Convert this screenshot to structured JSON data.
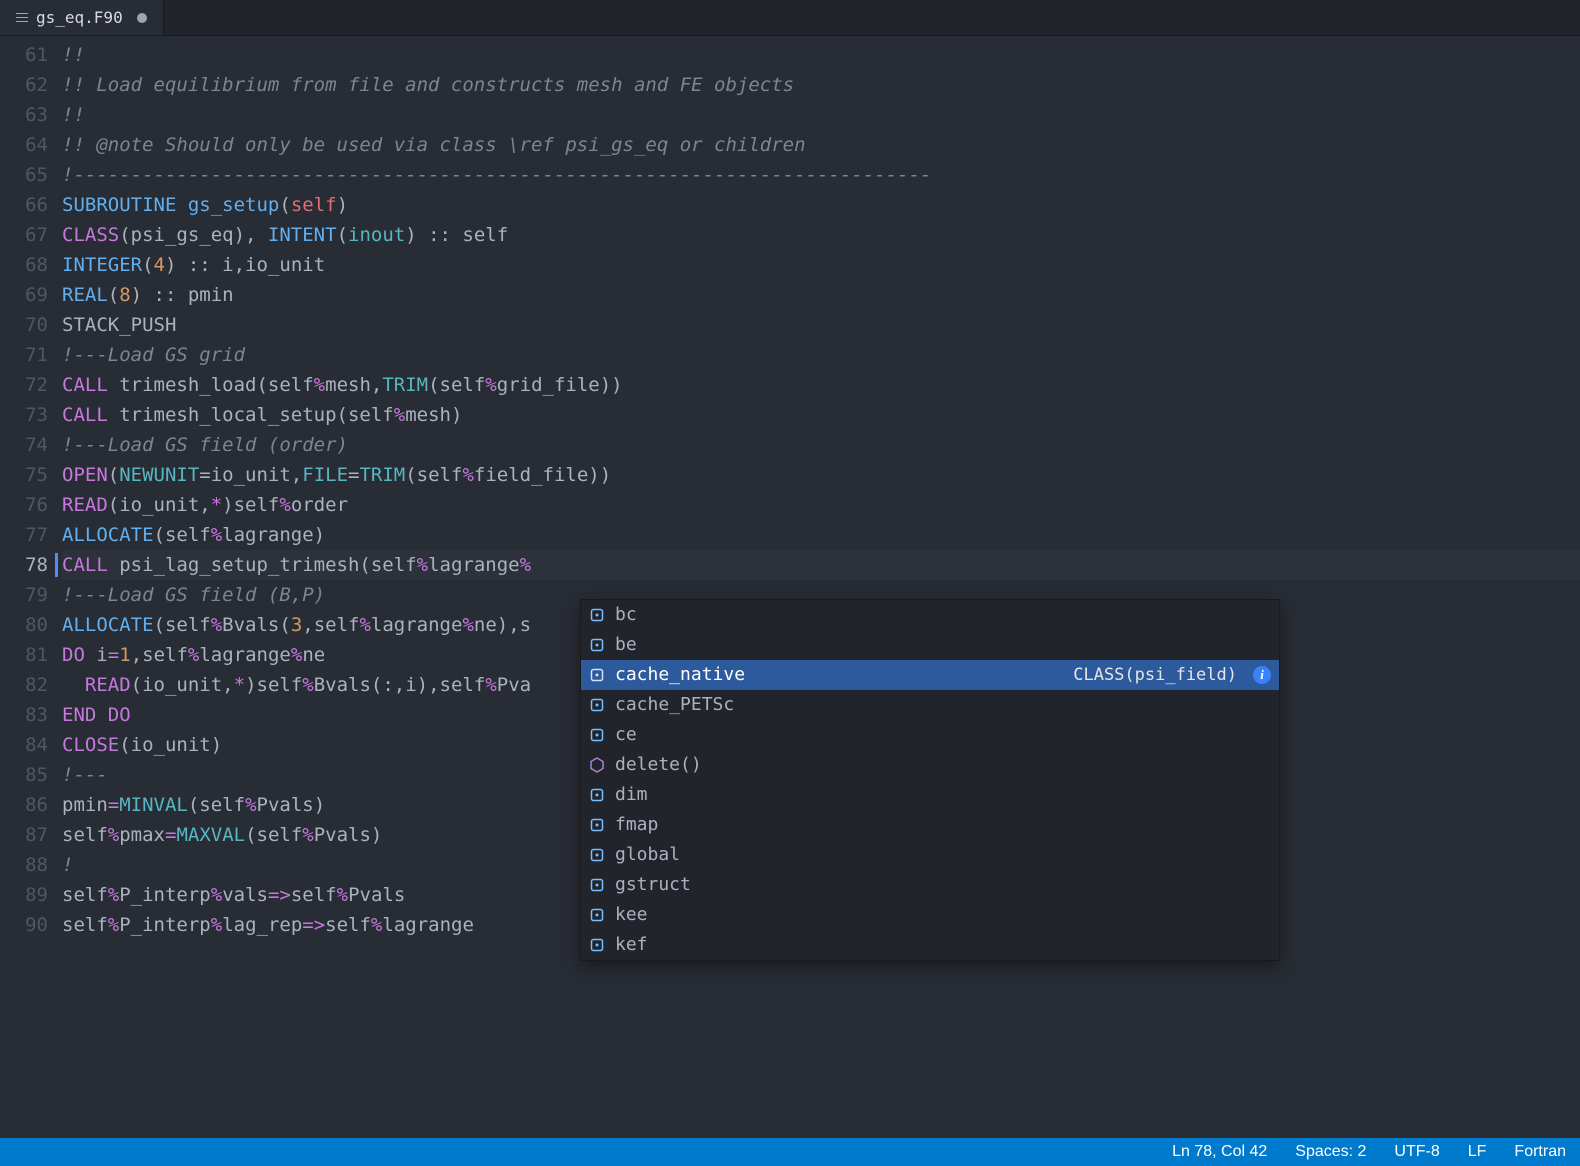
{
  "tab": {
    "file": "gs_eq.F90",
    "dirty": true
  },
  "editor": {
    "lines": [
      {
        "num": 61,
        "tokens": [
          {
            "c": "comment",
            "t": "!!"
          }
        ]
      },
      {
        "num": 62,
        "tokens": [
          {
            "c": "comment",
            "t": "!! Load equilibrium from file and constructs mesh and FE objects"
          }
        ]
      },
      {
        "num": 63,
        "tokens": [
          {
            "c": "comment",
            "t": "!!"
          }
        ]
      },
      {
        "num": 64,
        "tokens": [
          {
            "c": "comment",
            "t": "!! @note Should only be used via class \\ref psi_gs_eq or children"
          }
        ]
      },
      {
        "num": 65,
        "tokens": [
          {
            "c": "comment-dash",
            "t": "!---------------------------------------------------------------------------"
          }
        ]
      },
      {
        "num": 66,
        "tokens": [
          {
            "c": "keyword-blue",
            "t": "SUBROUTINE"
          },
          {
            "c": "ident",
            "t": " "
          },
          {
            "c": "call",
            "t": "gs_setup"
          },
          {
            "c": "punct",
            "t": "("
          },
          {
            "c": "self",
            "t": "self"
          },
          {
            "c": "punct",
            "t": ")"
          }
        ]
      },
      {
        "num": 67,
        "tokens": [
          {
            "c": "keyword",
            "t": "CLASS"
          },
          {
            "c": "punct",
            "t": "(psi_gs_eq), "
          },
          {
            "c": "keyword-blue",
            "t": "INTENT"
          },
          {
            "c": "punct",
            "t": "("
          },
          {
            "c": "type",
            "t": "inout"
          },
          {
            "c": "punct",
            "t": ") :: self"
          }
        ]
      },
      {
        "num": 68,
        "tokens": [
          {
            "c": "keyword-blue",
            "t": "INTEGER"
          },
          {
            "c": "punct",
            "t": "("
          },
          {
            "c": "num",
            "t": "4"
          },
          {
            "c": "punct",
            "t": ") :: i,io_unit"
          }
        ]
      },
      {
        "num": 69,
        "tokens": [
          {
            "c": "keyword-blue",
            "t": "REAL"
          },
          {
            "c": "punct",
            "t": "("
          },
          {
            "c": "num",
            "t": "8"
          },
          {
            "c": "punct",
            "t": ") :: pmin"
          }
        ]
      },
      {
        "num": 70,
        "tokens": [
          {
            "c": "ident",
            "t": "STACK_PUSH"
          }
        ]
      },
      {
        "num": 71,
        "tokens": [
          {
            "c": "comment",
            "t": "!---Load GS grid"
          }
        ]
      },
      {
        "num": 72,
        "tokens": [
          {
            "c": "keyword",
            "t": "CALL"
          },
          {
            "c": "ident",
            "t": " trimesh_load(self"
          },
          {
            "c": "keyword",
            "t": "%"
          },
          {
            "c": "ident",
            "t": "mesh,"
          },
          {
            "c": "builtin",
            "t": "TRIM"
          },
          {
            "c": "punct",
            "t": "(self"
          },
          {
            "c": "keyword",
            "t": "%"
          },
          {
            "c": "ident",
            "t": "grid_file))"
          }
        ]
      },
      {
        "num": 73,
        "tokens": [
          {
            "c": "keyword",
            "t": "CALL"
          },
          {
            "c": "ident",
            "t": " trimesh_local_setup(self"
          },
          {
            "c": "keyword",
            "t": "%"
          },
          {
            "c": "ident",
            "t": "mesh)"
          }
        ]
      },
      {
        "num": 74,
        "tokens": [
          {
            "c": "comment",
            "t": "!---Load GS field (order)"
          }
        ]
      },
      {
        "num": 75,
        "tokens": [
          {
            "c": "keyword",
            "t": "OPEN"
          },
          {
            "c": "punct",
            "t": "("
          },
          {
            "c": "type",
            "t": "NEWUNIT"
          },
          {
            "c": "punct",
            "t": "=io_unit,"
          },
          {
            "c": "type",
            "t": "FILE"
          },
          {
            "c": "punct",
            "t": "="
          },
          {
            "c": "builtin",
            "t": "TRIM"
          },
          {
            "c": "punct",
            "t": "(self"
          },
          {
            "c": "keyword",
            "t": "%"
          },
          {
            "c": "ident",
            "t": "field_file))"
          }
        ]
      },
      {
        "num": 76,
        "tokens": [
          {
            "c": "keyword",
            "t": "READ"
          },
          {
            "c": "punct",
            "t": "(io_unit,"
          },
          {
            "c": "keyword",
            "t": "*"
          },
          {
            "c": "punct",
            "t": ")self"
          },
          {
            "c": "keyword",
            "t": "%"
          },
          {
            "c": "ident",
            "t": "order"
          }
        ]
      },
      {
        "num": 77,
        "tokens": [
          {
            "c": "keyword-blue",
            "t": "ALLOCATE"
          },
          {
            "c": "punct",
            "t": "(self"
          },
          {
            "c": "keyword",
            "t": "%"
          },
          {
            "c": "ident",
            "t": "lagrange)"
          }
        ]
      },
      {
        "num": 78,
        "active": true,
        "tokens": [
          {
            "c": "keyword",
            "t": "CALL"
          },
          {
            "c": "ident",
            "t": " psi_lag_setup_trimesh(self"
          },
          {
            "c": "keyword",
            "t": "%"
          },
          {
            "c": "ident",
            "t": "lagrange"
          },
          {
            "c": "keyword",
            "t": "%"
          }
        ]
      },
      {
        "num": 79,
        "tokens": [
          {
            "c": "comment",
            "t": "!---Load GS field (B,P)"
          }
        ]
      },
      {
        "num": 80,
        "tokens": [
          {
            "c": "keyword-blue",
            "t": "ALLOCATE"
          },
          {
            "c": "punct",
            "t": "(self"
          },
          {
            "c": "keyword",
            "t": "%"
          },
          {
            "c": "ident",
            "t": "Bvals("
          },
          {
            "c": "num",
            "t": "3"
          },
          {
            "c": "punct",
            "t": ",self"
          },
          {
            "c": "keyword",
            "t": "%"
          },
          {
            "c": "ident",
            "t": "lagrange"
          },
          {
            "c": "keyword",
            "t": "%"
          },
          {
            "c": "ident",
            "t": "ne),s"
          }
        ]
      },
      {
        "num": 81,
        "tokens": [
          {
            "c": "keyword",
            "t": "DO"
          },
          {
            "c": "ident",
            "t": " i"
          },
          {
            "c": "keyword",
            "t": "="
          },
          {
            "c": "num",
            "t": "1"
          },
          {
            "c": "punct",
            "t": ",self"
          },
          {
            "c": "keyword",
            "t": "%"
          },
          {
            "c": "ident",
            "t": "lagrange"
          },
          {
            "c": "keyword",
            "t": "%"
          },
          {
            "c": "ident",
            "t": "ne"
          }
        ]
      },
      {
        "num": 82,
        "tokens": [
          {
            "c": "ident",
            "t": "  "
          },
          {
            "c": "keyword",
            "t": "READ"
          },
          {
            "c": "punct",
            "t": "(io_unit,"
          },
          {
            "c": "keyword",
            "t": "*"
          },
          {
            "c": "punct",
            "t": ")self"
          },
          {
            "c": "keyword",
            "t": "%"
          },
          {
            "c": "ident",
            "t": "Bvals(:,i),self"
          },
          {
            "c": "keyword",
            "t": "%"
          },
          {
            "c": "ident",
            "t": "Pva"
          }
        ]
      },
      {
        "num": 83,
        "tokens": [
          {
            "c": "keyword",
            "t": "END DO"
          }
        ]
      },
      {
        "num": 84,
        "tokens": [
          {
            "c": "keyword",
            "t": "CLOSE"
          },
          {
            "c": "punct",
            "t": "(io_unit)"
          }
        ]
      },
      {
        "num": 85,
        "tokens": [
          {
            "c": "comment",
            "t": "!---"
          }
        ]
      },
      {
        "num": 86,
        "tokens": [
          {
            "c": "ident",
            "t": "pmin"
          },
          {
            "c": "keyword",
            "t": "="
          },
          {
            "c": "builtin",
            "t": "MINVAL"
          },
          {
            "c": "punct",
            "t": "(self"
          },
          {
            "c": "keyword",
            "t": "%"
          },
          {
            "c": "ident",
            "t": "Pvals)"
          }
        ]
      },
      {
        "num": 87,
        "tokens": [
          {
            "c": "ident",
            "t": "self"
          },
          {
            "c": "keyword",
            "t": "%"
          },
          {
            "c": "ident",
            "t": "pmax"
          },
          {
            "c": "keyword",
            "t": "="
          },
          {
            "c": "builtin",
            "t": "MAXVAL"
          },
          {
            "c": "punct",
            "t": "(self"
          },
          {
            "c": "keyword",
            "t": "%"
          },
          {
            "c": "ident",
            "t": "Pvals)"
          }
        ]
      },
      {
        "num": 88,
        "tokens": [
          {
            "c": "comment",
            "t": "!"
          }
        ]
      },
      {
        "num": 89,
        "tokens": [
          {
            "c": "ident",
            "t": "self"
          },
          {
            "c": "keyword",
            "t": "%"
          },
          {
            "c": "ident",
            "t": "P_interp"
          },
          {
            "c": "keyword",
            "t": "%"
          },
          {
            "c": "ident",
            "t": "vals"
          },
          {
            "c": "keyword",
            "t": "=>"
          },
          {
            "c": "ident",
            "t": "self"
          },
          {
            "c": "keyword",
            "t": "%"
          },
          {
            "c": "ident",
            "t": "Pvals"
          }
        ]
      },
      {
        "num": 90,
        "tokens": [
          {
            "c": "ident",
            "t": "self"
          },
          {
            "c": "keyword",
            "t": "%"
          },
          {
            "c": "ident",
            "t": "P_interp"
          },
          {
            "c": "keyword",
            "t": "%"
          },
          {
            "c": "ident",
            "t": "lag_rep"
          },
          {
            "c": "keyword",
            "t": "=>"
          },
          {
            "c": "ident",
            "t": "self"
          },
          {
            "c": "keyword",
            "t": "%"
          },
          {
            "c": "ident",
            "t": "lagrange"
          }
        ]
      }
    ]
  },
  "suggest": {
    "items": [
      {
        "icon": "field",
        "label": "bc"
      },
      {
        "icon": "field",
        "label": "be"
      },
      {
        "icon": "field",
        "label": "cache_native",
        "selected": true,
        "type": "CLASS(psi_field)"
      },
      {
        "icon": "field",
        "label": "cache_PETSc"
      },
      {
        "icon": "field",
        "label": "ce"
      },
      {
        "icon": "method",
        "label": "delete()"
      },
      {
        "icon": "field",
        "label": "dim"
      },
      {
        "icon": "field",
        "label": "fmap"
      },
      {
        "icon": "field",
        "label": "global"
      },
      {
        "icon": "field",
        "label": "gstruct"
      },
      {
        "icon": "field",
        "label": "kee"
      },
      {
        "icon": "field",
        "label": "kef"
      }
    ]
  },
  "status": {
    "position": "Ln 78, Col 42",
    "spaces": "Spaces: 2",
    "encoding": "UTF-8",
    "eol": "LF",
    "language": "Fortran"
  }
}
